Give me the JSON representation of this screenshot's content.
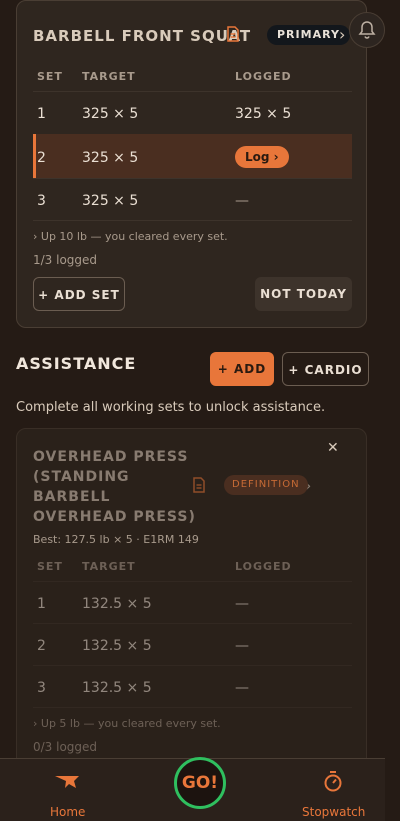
{
  "primary_exercise": {
    "title": "BARBELL FRONT SQUAT",
    "badge": "PRIMARY",
    "headers": {
      "set": "SET",
      "target": "TARGET",
      "logged": "LOGGED"
    },
    "rows": [
      {
        "set": "1",
        "target": "325 × 5",
        "logged": "325 × 5"
      },
      {
        "set": "2",
        "target": "325 × 5",
        "logged": "Log ›"
      },
      {
        "set": "3",
        "target": "325 × 5",
        "logged": "—"
      }
    ],
    "hint": "›  Up 10 lb — you cleared every set.",
    "logged_count": "1/3 logged",
    "add_set_label": "+ ADD SET",
    "not_today_label": "NOT TODAY"
  },
  "assistance": {
    "title": "ASSISTANCE",
    "add_label": "+ ADD",
    "cardio_label": "+ CARDIO",
    "info": "Complete all working sets to unlock assistance."
  },
  "assist_exercise": {
    "title_lines": [
      "OVERHEAD PRESS",
      "(STANDING",
      "BARBELL",
      "OVERHEAD PRESS)"
    ],
    "badge": "DEFINITION",
    "best": "Best: 127.5 lb × 5 · E1RM 149",
    "headers": {
      "set": "SET",
      "target": "TARGET",
      "logged": "LOGGED"
    },
    "rows": [
      {
        "set": "1",
        "target": "132.5 × 5",
        "logged": "—"
      },
      {
        "set": "2",
        "target": "132.5 × 5",
        "logged": "—"
      },
      {
        "set": "3",
        "target": "132.5 × 5",
        "logged": "—"
      }
    ],
    "hint": "›  Up 5 lb — you cleared every set.",
    "logged_count": "0/3 logged"
  },
  "tabbar": {
    "home_label": "Home",
    "go_label": "GO!",
    "stopwatch_label": "Stopwatch"
  },
  "colors": {
    "accent": "#e8763a",
    "go_ring": "#2fbf5f",
    "background": "#251b15",
    "card": "#2f261f"
  }
}
